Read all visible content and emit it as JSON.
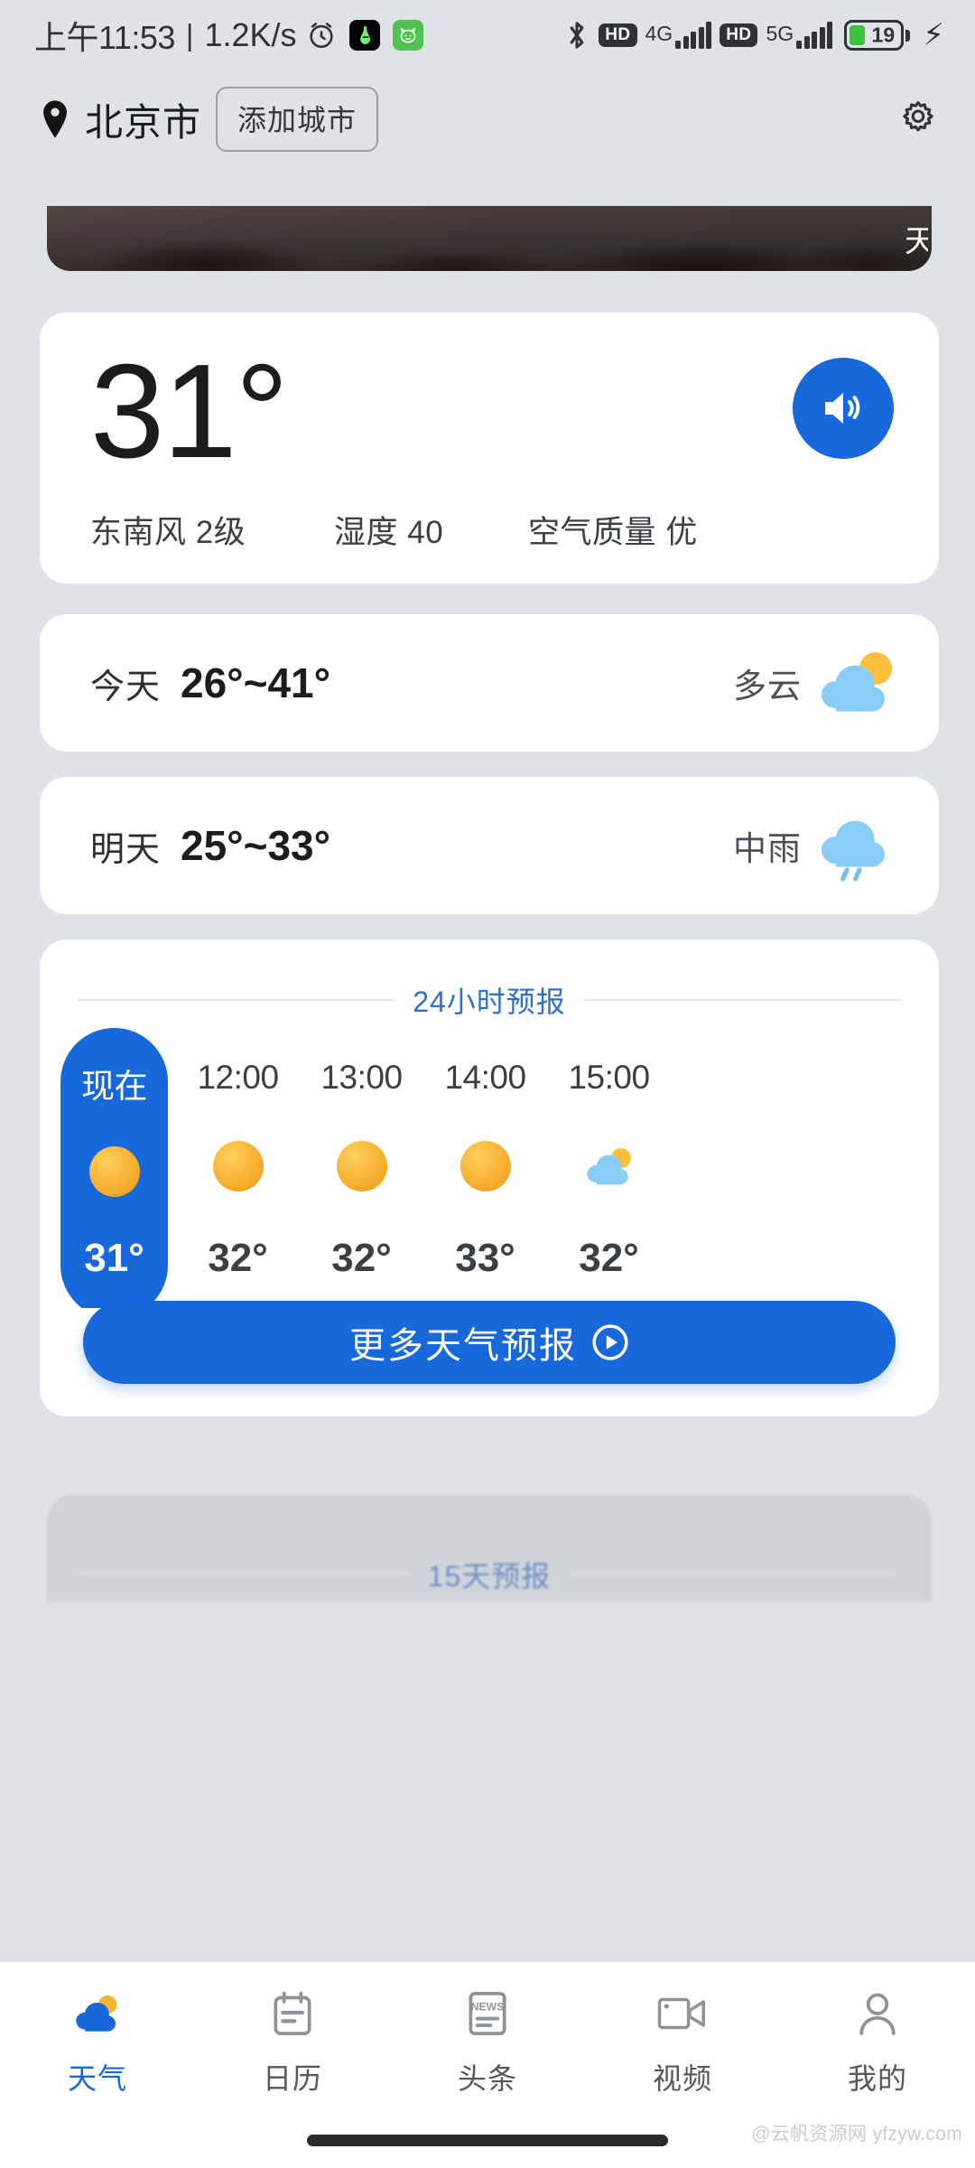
{
  "status_bar": {
    "time": "上午11:53",
    "divider": "|",
    "net_speed": "1.2K/s",
    "alarm_icon": "alarm-clock-icon",
    "app_icons": [
      "app-badge-dark-icon",
      "app-badge-green-icon"
    ],
    "bluetooth_icon": "bluetooth-icon",
    "volte_badge_1": "HD",
    "network_1": "4G",
    "volte_badge_2": "HD",
    "network_2": "5G",
    "battery_percent": "19",
    "charging_icon": "charging-bolt-icon"
  },
  "header": {
    "location_icon": "location-pin-icon",
    "city": "北京市",
    "add_city_label": "添加城市",
    "settings_icon": "gear-icon"
  },
  "banner": {
    "clipped_text": "天"
  },
  "current": {
    "temperature": "31°",
    "speaker_icon": "volume-speaker-icon",
    "metrics": [
      "东南风 2级",
      "湿度 40",
      "空气质量 优"
    ]
  },
  "daily": [
    {
      "label": "今天",
      "range": "26°~41°",
      "desc": "多云",
      "icon": "partly-cloudy-icon"
    },
    {
      "label": "明天",
      "range": "25°~33°",
      "desc": "中雨",
      "icon": "moderate-rain-icon"
    }
  ],
  "hourly": {
    "title": "24小时预报",
    "items": [
      {
        "time": "现在",
        "temp": "31°",
        "icon": "sun-icon",
        "active": true
      },
      {
        "time": "12:00",
        "temp": "32°",
        "icon": "sun-icon",
        "active": false
      },
      {
        "time": "13:00",
        "temp": "32°",
        "icon": "sun-icon",
        "active": false
      },
      {
        "time": "14:00",
        "temp": "33°",
        "icon": "sun-icon",
        "active": false
      },
      {
        "time": "15:00",
        "temp": "32°",
        "icon": "partly-cloudy-icon",
        "active": false
      }
    ],
    "more_button_label": "更多天气预报",
    "more_button_icon": "play-circle-icon"
  },
  "fifteen_day": {
    "title": "15天预报"
  },
  "bottom_nav": [
    {
      "label": "天气",
      "icon": "cloud-sun-icon",
      "active": true
    },
    {
      "label": "日历",
      "icon": "calendar-icon",
      "active": false
    },
    {
      "label": "头条",
      "icon": "news-icon",
      "active": false
    },
    {
      "label": "视频",
      "icon": "video-camera-icon",
      "active": false
    },
    {
      "label": "我的",
      "icon": "person-icon",
      "active": false
    }
  ],
  "watermark": "@云帆资源网 yfzyw.com",
  "colors": {
    "accent_blue": "#1668db",
    "page_background": "#dfe3e6",
    "card_background": "#ffffff",
    "sun_orange": "#f5a623",
    "cloud_blue": "#7ec8f5",
    "battery_green": "#39c339"
  }
}
